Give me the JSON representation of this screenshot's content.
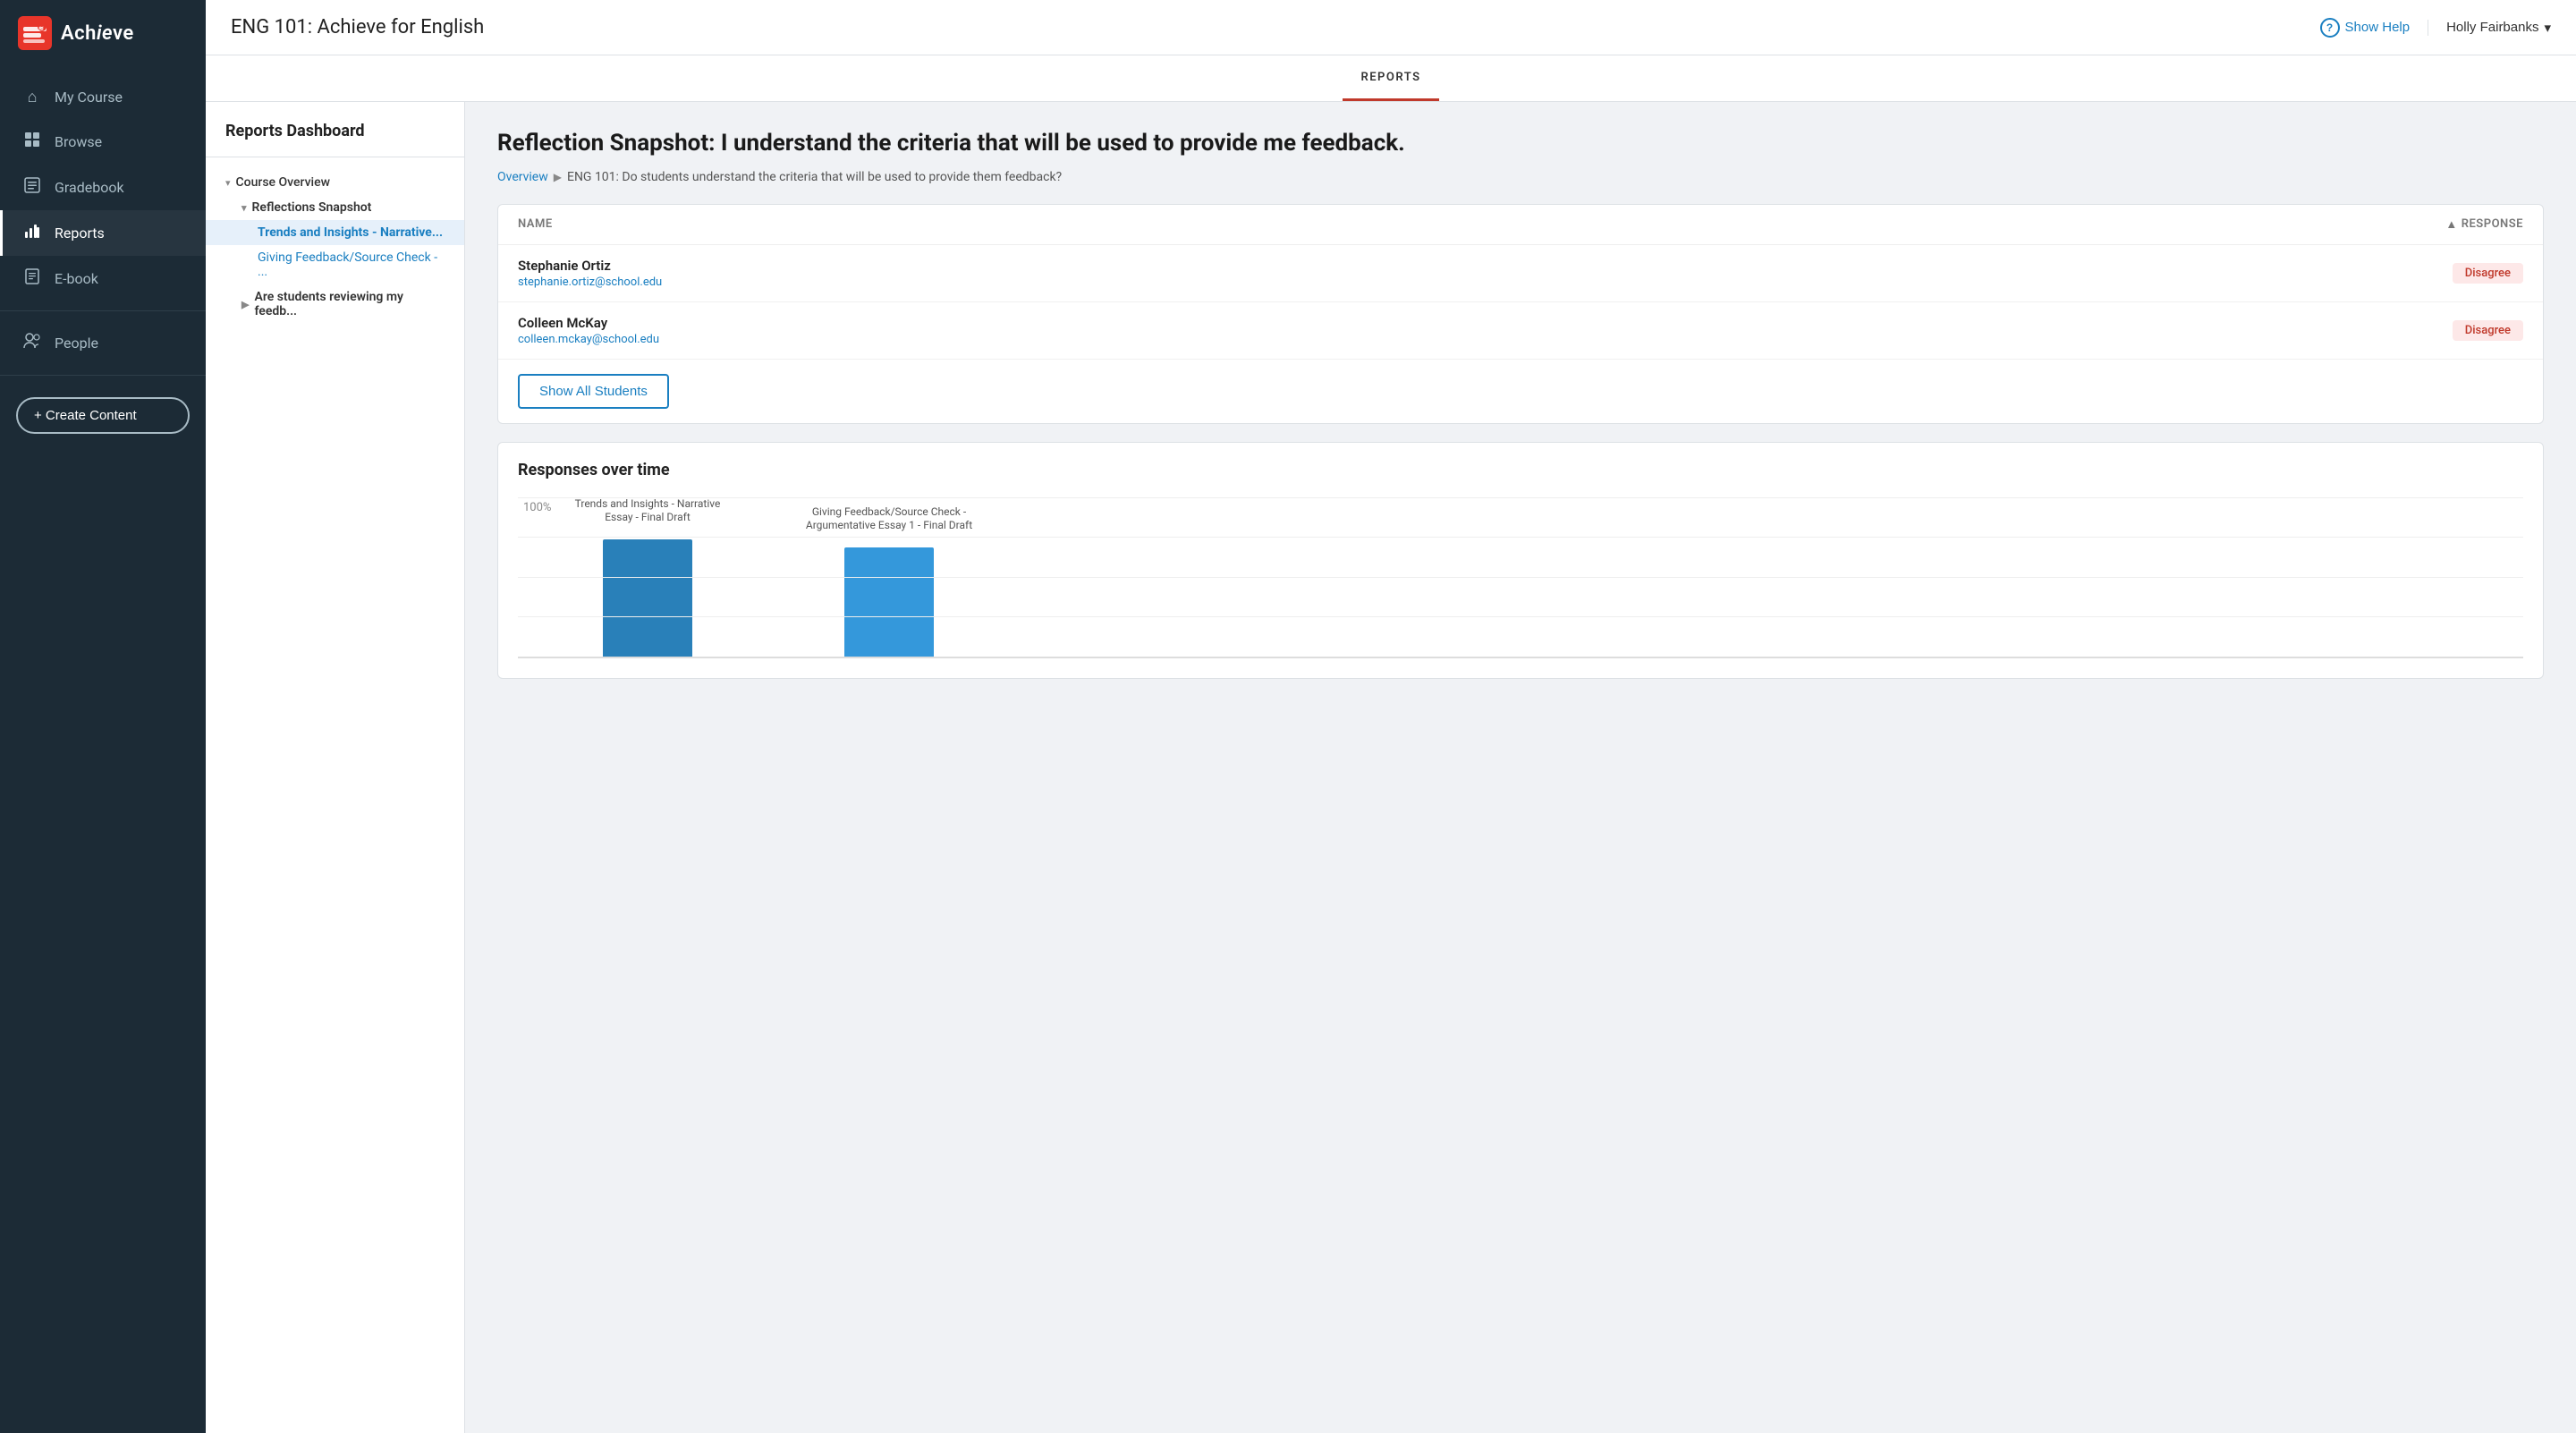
{
  "logo": {
    "icon_text": "≋",
    "text_part1": "Achie",
    "text_part2": "ve"
  },
  "sidebar": {
    "nav_items": [
      {
        "id": "my-course",
        "label": "My Course",
        "icon": "⌂",
        "active": false
      },
      {
        "id": "browse",
        "label": "Browse",
        "icon": "▣",
        "active": false
      },
      {
        "id": "gradebook",
        "label": "Gradebook",
        "icon": "◧",
        "active": false
      },
      {
        "id": "reports",
        "label": "Reports",
        "icon": "▥",
        "active": true
      },
      {
        "id": "ebook",
        "label": "E-book",
        "icon": "☰",
        "active": false
      },
      {
        "id": "people",
        "label": "People",
        "icon": "👤",
        "active": false
      }
    ],
    "create_label": "+ Create Content"
  },
  "header": {
    "page_title": "ENG 101: Achieve for English",
    "show_help_label": "Show Help",
    "user_name": "Holly Fairbanks",
    "user_dropdown": "▾"
  },
  "tabs": {
    "active_tab": "REPORTS"
  },
  "reports_sidebar": {
    "title": "Reports Dashboard",
    "tree": {
      "course_overview_label": "Course Overview",
      "reflections_snapshot_label": "Reflections Snapshot",
      "trends_insights_label": "Trends and Insights - Narrative...",
      "giving_feedback_label": "Giving Feedback/Source Check - ...",
      "are_students_label": "Are students reviewing my feedb..."
    }
  },
  "report_content": {
    "heading": "Reflection Snapshot: I understand the criteria that will be used to provide me feedback.",
    "breadcrumb_overview": "Overview",
    "breadcrumb_separator": "▶",
    "breadcrumb_detail": "ENG 101: Do students understand the criteria that will be used to provide them feedback?",
    "table": {
      "col_name": "Name",
      "col_response": "Response",
      "sort_arrow": "▲",
      "students": [
        {
          "name": "Stephanie Ortiz",
          "email": "stephanie.ortiz@school.edu",
          "response": "Disagree",
          "response_color": "#fde8e8"
        },
        {
          "name": "Colleen McKay",
          "email": "colleen.mckay@school.edu",
          "response": "Disagree",
          "response_color": "#fde8e8"
        }
      ],
      "show_all_label": "Show All Students"
    },
    "chart": {
      "title": "Responses over time",
      "y_label": "100%",
      "bars": [
        {
          "label": "Trends and Insights - Narrative Essay - Final Draft",
          "height_pct": 85,
          "color": "#2980b9"
        },
        {
          "label": "Giving Feedback/Source Check - Argumentative Essay 1 - Final Draft",
          "height_pct": 78,
          "color": "#3498db"
        }
      ]
    }
  }
}
